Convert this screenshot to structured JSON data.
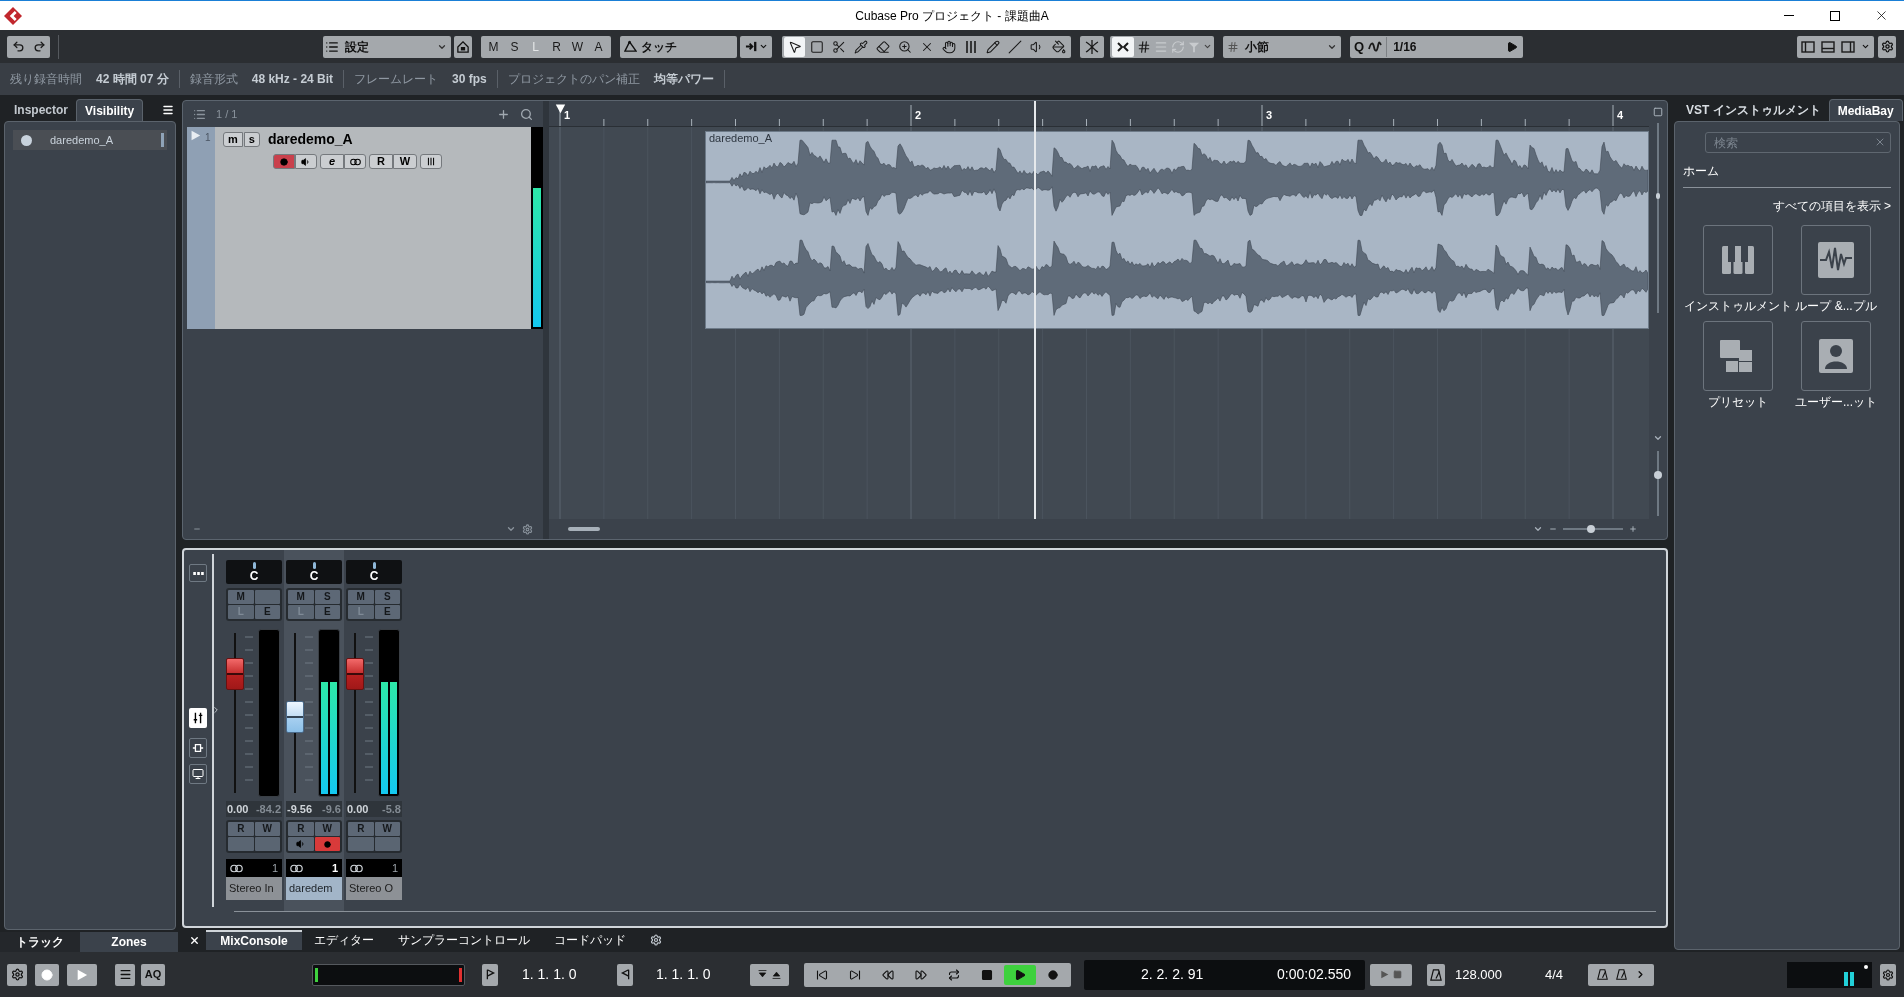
{
  "window": {
    "title": "Cubase Pro プロジェクト - 課題曲A"
  },
  "toolbar": {
    "automation_preset": "設定",
    "automation_buttons": [
      {
        "label": "M",
        "disabled": false
      },
      {
        "label": "S",
        "disabled": false
      },
      {
        "label": "L",
        "disabled": true
      },
      {
        "label": "R",
        "disabled": false
      },
      {
        "label": "W",
        "disabled": false
      },
      {
        "label": "A",
        "disabled": false
      }
    ],
    "automation_mode": "タッチ",
    "tools": [
      {
        "kind": "select",
        "selected": true
      },
      {
        "kind": "range",
        "selected": false
      },
      {
        "kind": "split",
        "selected": false
      },
      {
        "kind": "glue",
        "selected": false
      },
      {
        "kind": "erase",
        "selected": false
      },
      {
        "kind": "zoom",
        "selected": false
      },
      {
        "kind": "mute",
        "selected": false
      },
      {
        "kind": "hand",
        "selected": false
      },
      {
        "kind": "warp",
        "selected": false
      },
      {
        "kind": "draw",
        "selected": false
      },
      {
        "kind": "line",
        "selected": false
      },
      {
        "kind": "play",
        "selected": false
      },
      {
        "kind": "color",
        "selected": false
      }
    ],
    "snap_on": true,
    "grid_type": "小節",
    "quantize_label": "Q",
    "quantize": "1/16"
  },
  "status_line": [
    {
      "label": "残り録音時間",
      "value": "42 時間 07 分"
    },
    {
      "label": "録音形式",
      "value": "48 kHz - 24 Bit"
    },
    {
      "label": "フレームレート",
      "value": "30 fps"
    },
    {
      "label": "プロジェクトのパン補正",
      "value": "均等パワー"
    }
  ],
  "left_zone": {
    "tabs": [
      {
        "label": "Inspector",
        "selected": false
      },
      {
        "label": "Visibility",
        "selected": true
      }
    ],
    "visibility_items": [
      {
        "name": "daredemo_A",
        "visible": true
      }
    ],
    "bottom_tabs": [
      {
        "label": "トラック",
        "selected": false
      },
      {
        "label": "Zones",
        "selected": true
      }
    ]
  },
  "project": {
    "track_count": "1 / 1",
    "ruler": [
      "1",
      "2",
      "3",
      "4"
    ],
    "tracks": [
      {
        "number": "1",
        "name": "daredemo_A",
        "mute_label": "m",
        "solo_label": "s",
        "edit_label": "e",
        "read_label": "R",
        "write_label": "W",
        "mute": false,
        "solo": false,
        "record_enabled": true,
        "monitor": false,
        "read": false,
        "write": false,
        "level": 0.7
      }
    ],
    "event": {
      "name": "daredemo_A"
    },
    "zoom_slider": {
      "level": 0.47
    },
    "vertical_zoom": {
      "level": 0.65
    }
  },
  "mixer": {
    "channels": [
      {
        "kind": "input",
        "selected": false,
        "pan": "C",
        "top_buttons": [
          {
            "label": "M",
            "disabled": false
          }
        ],
        "bottom_buttons": [
          {
            "label": "L",
            "disabled": true
          },
          {
            "label": "E",
            "disabled": false
          }
        ],
        "fader": {
          "level": 0.79
        },
        "meter": {
          "level": 0
        },
        "volume": "0.00",
        "peak": "-84.2",
        "automation": [
          "R",
          "W"
        ],
        "routing": "1",
        "name": "Stereo In"
      },
      {
        "kind": "audio",
        "selected": true,
        "pan": "C",
        "top_buttons": [
          {
            "label": "M",
            "disabled": false
          },
          {
            "label": "S",
            "disabled": false
          }
        ],
        "bottom_buttons": [
          {
            "label": "L",
            "disabled": true
          },
          {
            "label": "E",
            "disabled": false
          }
        ],
        "fader": {
          "level": 0.47
        },
        "meter": {
          "level": 0.74
        },
        "volume": "-9.56",
        "peak": "-9.6",
        "automation": [
          "R",
          "W"
        ],
        "monitor": false,
        "record_enabled": true,
        "routing": "1",
        "name": "daredem"
      },
      {
        "kind": "output",
        "selected": false,
        "pan": "C",
        "top_buttons": [
          {
            "label": "M",
            "disabled": false
          },
          {
            "label": "S",
            "disabled": false
          }
        ],
        "bottom_buttons": [
          {
            "label": "L",
            "disabled": true
          },
          {
            "label": "E",
            "disabled": false
          }
        ],
        "fader": {
          "level": 0.79
        },
        "meter": {
          "level": 0.74
        },
        "volume": "0.00",
        "peak": "-5.8",
        "automation": [
          "R",
          "W"
        ],
        "routing": "1",
        "name": "Stereo O"
      }
    ]
  },
  "lower_zone": {
    "tabs": [
      {
        "label": "MixConsole",
        "selected": true
      },
      {
        "label": "エディター",
        "selected": false
      },
      {
        "label": "サンプラーコントロール",
        "selected": false
      },
      {
        "label": "コードパッド",
        "selected": false
      }
    ]
  },
  "right_zone": {
    "tabs": [
      {
        "label": "VST インストゥルメント",
        "selected": false
      },
      {
        "label": "MediaBay",
        "selected": true
      }
    ],
    "search": {
      "placeholder": "検索"
    },
    "home": "ホーム",
    "show_all": "すべての項目を表示 >",
    "tiles": [
      {
        "kind": "piano",
        "label": "インストゥルメント"
      },
      {
        "kind": "wave",
        "label": "ループ &...プル"
      },
      {
        "kind": "preset",
        "label": "プリセット"
      },
      {
        "kind": "user",
        "label": "ユーザー...ット"
      }
    ]
  },
  "transport": {
    "auto_quantize": "AQ",
    "left_locator": "1. 1. 1. 0",
    "right_locator": "1. 1. 1. 0",
    "buttons": [
      {
        "kind": "start",
        "on": false
      },
      {
        "kind": "end",
        "on": false
      },
      {
        "kind": "rewind",
        "on": false
      },
      {
        "kind": "forward",
        "on": false
      },
      {
        "kind": "cycle",
        "on": false
      },
      {
        "kind": "stop",
        "on": false
      },
      {
        "kind": "play",
        "on": true
      },
      {
        "kind": "record",
        "on": false
      }
    ],
    "position_primary": "2. 2. 2. 91",
    "position_secondary": "0:00:02.550",
    "tempo": "128.000",
    "signature": "4/4"
  }
}
